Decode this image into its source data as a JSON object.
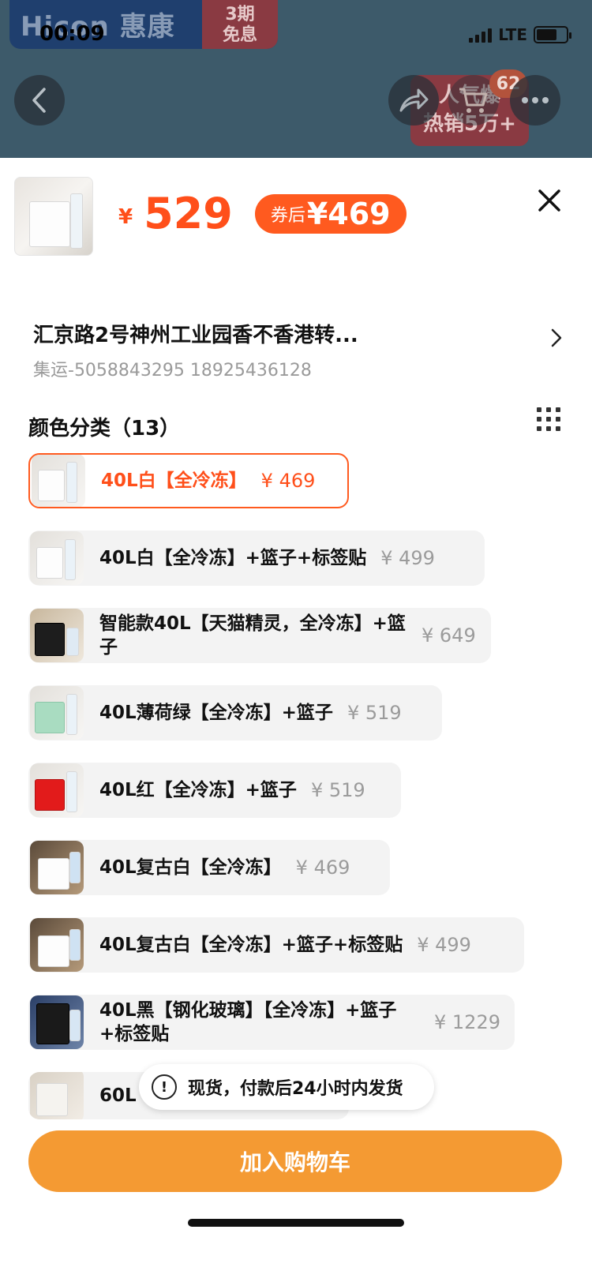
{
  "status": {
    "time": "00:09",
    "network": "LTE"
  },
  "header": {
    "brand": "Hicon 惠康",
    "brand_promo": "3期\n免息",
    "promo_badge": "人气爆\n热销5万+",
    "cart_count": "62"
  },
  "product": {
    "currency": "¥",
    "price": "529",
    "coupon_label": "券后",
    "coupon_price": "¥469"
  },
  "address": {
    "line1": "汇京路2号神州工业园香不香港转...",
    "line2": "集运-5058843295 18925436128"
  },
  "section": {
    "title": "颜色分类（13）"
  },
  "options": [
    {
      "label": "40L白【全冷冻】",
      "price": "¥ 469",
      "selected": true
    },
    {
      "label": "40L白【全冷冻】+篮子+标签贴",
      "price": "¥ 499"
    },
    {
      "label": "智能款40L【天猫精灵，全冷冻】+篮子",
      "price": "¥ 649"
    },
    {
      "label": "40L薄荷绿【全冷冻】+篮子",
      "price": "¥ 519"
    },
    {
      "label": "40L红【全冷冻】+篮子",
      "price": "¥ 519"
    },
    {
      "label": "40L复古白【全冷冻】",
      "price": "¥ 469"
    },
    {
      "label": "40L复古白【全冷冻】+篮子+标签贴",
      "price": "¥ 499"
    },
    {
      "label": "40L黑【钢化玻璃】【全冷冻】+篮子+标签贴",
      "price": "¥ 1229"
    },
    {
      "label": "60L",
      "price": ""
    }
  ],
  "toast": {
    "text": "现货，付款后24小时内发货"
  },
  "actions": {
    "add_to_cart": "加入购物车"
  },
  "colors": {
    "accent": "#ff4f1a",
    "button": "#f49a33"
  }
}
